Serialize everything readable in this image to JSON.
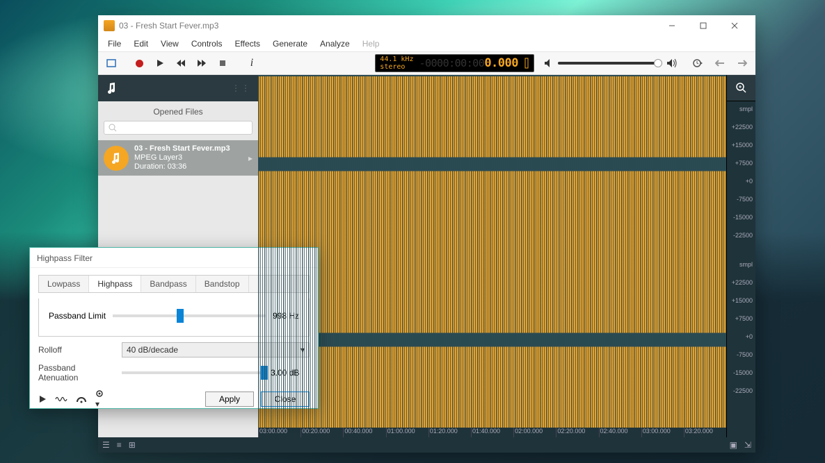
{
  "window": {
    "title": "03 - Fresh Start Fever.mp3"
  },
  "menu": {
    "items": [
      {
        "id": "file",
        "label": "File"
      },
      {
        "id": "edit",
        "label": "Edit"
      },
      {
        "id": "view",
        "label": "View"
      },
      {
        "id": "controls",
        "label": "Controls"
      },
      {
        "id": "effects",
        "label": "Effects"
      },
      {
        "id": "generate",
        "label": "Generate"
      },
      {
        "id": "analyze",
        "label": "Analyze"
      },
      {
        "id": "help",
        "label": "Help"
      }
    ]
  },
  "lcd": {
    "rate": "44.1 kHz",
    "channels": "stereo",
    "time_grey": "-0000:00:00",
    "time_hl": "0.000"
  },
  "sidebar": {
    "title": "Opened Files",
    "search_placeholder": "",
    "file": {
      "name": "03 - Fresh Start Fever.mp3",
      "codec": "MPEG Layer3",
      "duration_label": "Duration: 03:36"
    }
  },
  "amp": {
    "unit": "smpl",
    "track1": [
      "+22500",
      "+15000",
      "+7500",
      "+0",
      "-7500",
      "-15000",
      "-22500"
    ],
    "track2": [
      "+22500",
      "+15000",
      "+7500",
      "+0",
      "-7500",
      "-15000",
      "-22500"
    ]
  },
  "timeline": [
    "03:00.000",
    "00:20.000",
    "00:40.000",
    "01:00.000",
    "01:20.000",
    "01:40.000",
    "02:00.000",
    "02:20.000",
    "02:40.000",
    "03:00.000",
    "03:20.000"
  ],
  "dialog": {
    "title": "Highpass Filter",
    "tabs": [
      {
        "id": "lowpass",
        "label": "Lowpass"
      },
      {
        "id": "highpass",
        "label": "Highpass"
      },
      {
        "id": "bandpass",
        "label": "Bandpass"
      },
      {
        "id": "bandstop",
        "label": "Bandstop"
      }
    ],
    "active_tab": "highpass",
    "passband_label": "Passband Limit",
    "passband_value": "998 Hz",
    "passband_pos_pct": 42,
    "rolloff_label": "Rolloff",
    "rolloff_value": "40 dB/decade",
    "atten_label": "Passband Atenuation",
    "atten_value": "3.00 dB",
    "atten_pos_pct": 98,
    "apply": "Apply",
    "close": "Close"
  }
}
